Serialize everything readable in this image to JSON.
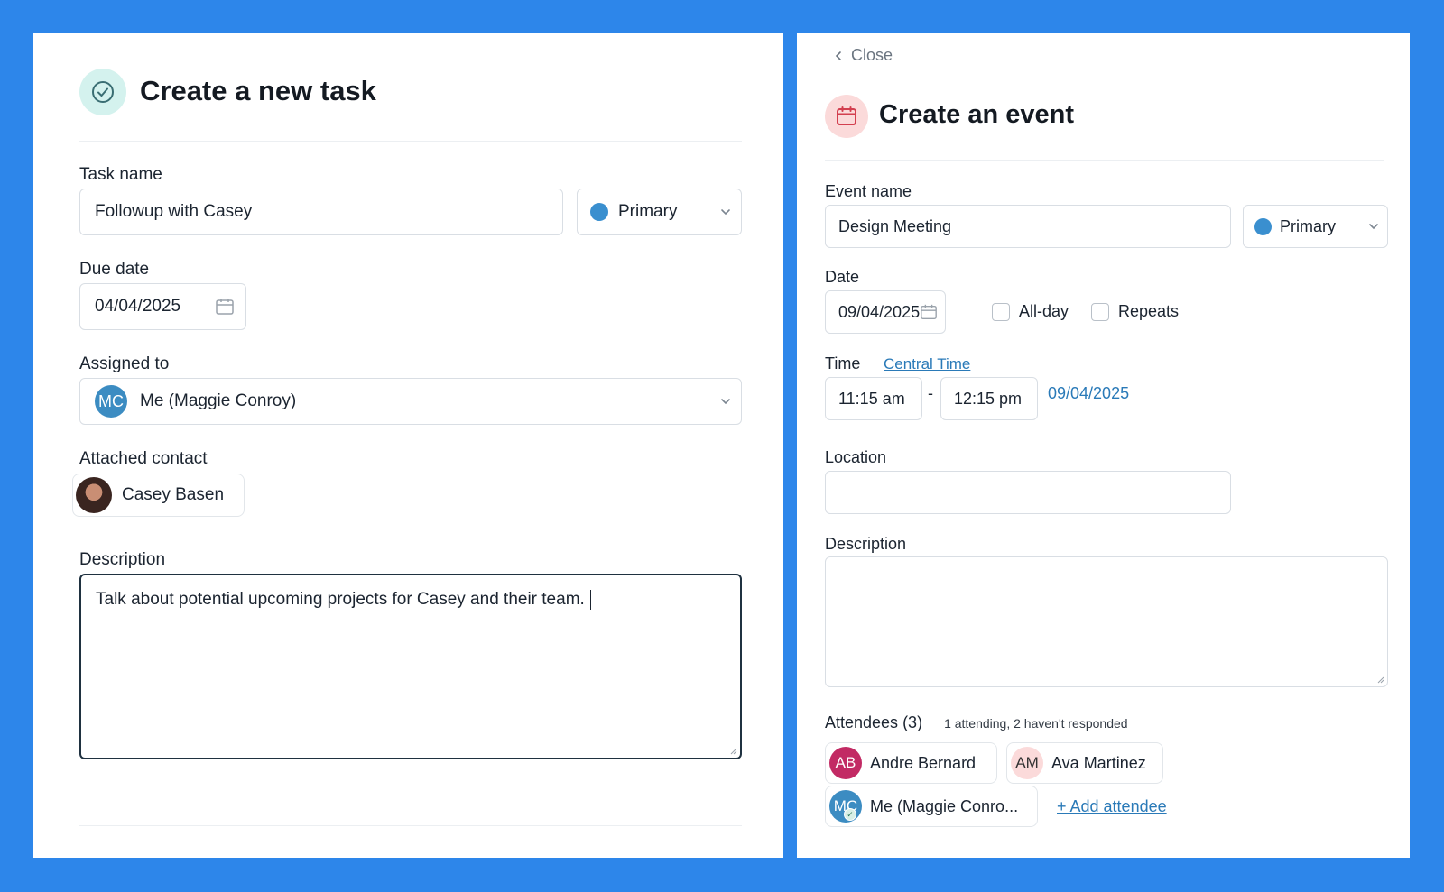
{
  "task_form": {
    "title": "Create a new task",
    "task_name_label": "Task name",
    "task_name_value": "Followup with Casey",
    "calendar_select": "Primary",
    "due_date_label": "Due date",
    "due_date_value": "04/04/2025",
    "assigned_label": "Assigned to",
    "assigned_initials": "MC",
    "assigned_value": "Me (Maggie Conroy)",
    "contact_label": "Attached contact",
    "contact_name": "Casey Basen",
    "description_label": "Description",
    "description_value": "Talk about potential upcoming projects for Casey and their team."
  },
  "event_form": {
    "close_label": "Close",
    "title": "Create an event",
    "event_name_label": "Event name",
    "event_name_value": "Design Meeting",
    "calendar_select": "Primary",
    "date_label": "Date",
    "date_value": "09/04/2025",
    "allday_label": "All-day",
    "repeats_label": "Repeats",
    "time_label": "Time",
    "timezone_link": "Central Time",
    "start_time": "11:15 am",
    "time_separator": "-",
    "end_time": "12:15 pm",
    "end_date_link": "09/04/2025",
    "location_label": "Location",
    "location_value": "",
    "description_label": "Description",
    "description_value": "",
    "attendees_label": "Attendees (3)",
    "attendees_status": "1 attending, 2 haven't responded",
    "attendees": [
      {
        "initials": "AB",
        "name": "Andre Bernard"
      },
      {
        "initials": "AM",
        "name": "Ava Martinez"
      },
      {
        "initials": "MC",
        "name": "Me (Maggie Conro..."
      }
    ],
    "add_attendee": "+ Add attendee"
  },
  "colors": {
    "background": "#2d86ea",
    "primary_dot": "#3a8fcf",
    "task_icon_bg": "#d4f2ee",
    "event_icon_bg": "#fbdada",
    "link": "#2a7ab8"
  }
}
